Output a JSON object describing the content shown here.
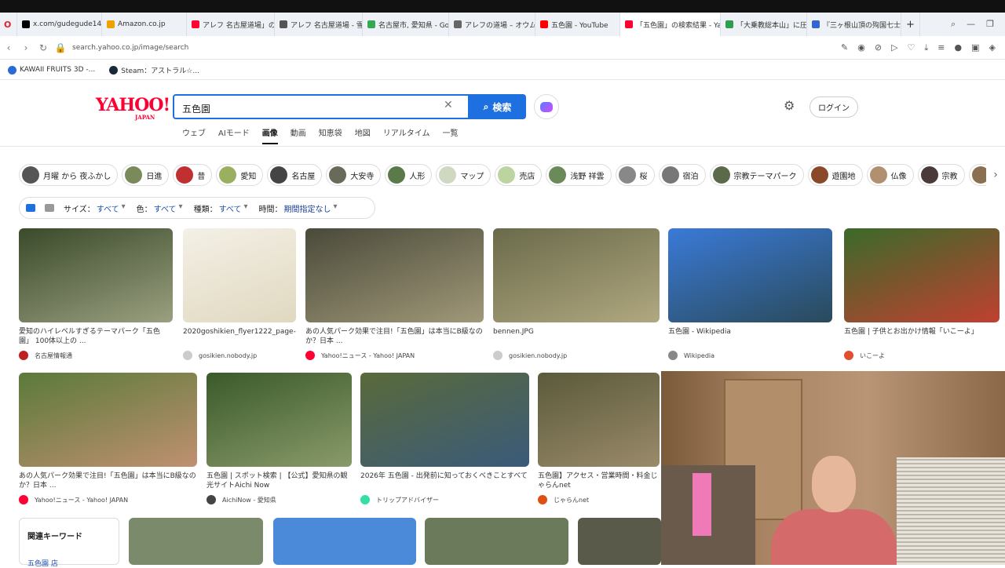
{
  "browser": {
    "tabs": [
      {
        "label": "x.com/gudegude147/...",
        "color": "#000000"
      },
      {
        "label": "Amazon.co.jp",
        "color": "#f0a000"
      },
      {
        "label": "アレフ 名古屋道場」の...",
        "color": "#ff0033"
      },
      {
        "label": "アレフ 名古屋道場 - 雪...",
        "color": "#555555"
      },
      {
        "label": "名古屋市, 愛知県 - Go...",
        "color": "#34a853"
      },
      {
        "label": "アレフの道場 – オウム真...",
        "color": "#666666"
      },
      {
        "label": "五色園 - YouTube",
        "color": "#ff0000"
      },
      {
        "label": "「五色園」の検索結果 - Yah...",
        "color": "#ff0033"
      },
      {
        "label": "「大乗教総本山」に圧倒...",
        "color": "#2e9e4e"
      },
      {
        "label": "『三ヶ根山頂の殉国七士...",
        "color": "#3366cc"
      }
    ],
    "url": "search.yahoo.co.jp/image/search",
    "bookmarks": [
      {
        "label": "KAWAII FRUITS 3D -...",
        "color": "#2a6bd6"
      },
      {
        "label": "Steam：アストラル☆...",
        "color": "#1b2838"
      }
    ]
  },
  "header": {
    "logo": "YAHOO!",
    "logo_sub": "JAPAN",
    "query": "五色園",
    "search_label": "検索",
    "login_label": "ログイン",
    "tabs": [
      "ウェブ",
      "AIモード",
      "画像",
      "動画",
      "知恵袋",
      "地図",
      "リアルタイム",
      "一覧"
    ]
  },
  "chips": [
    {
      "label": "月曜 から 夜ふかし",
      "color": "#555555"
    },
    {
      "label": "日進",
      "color": "#7a8a5a"
    },
    {
      "label": "昔",
      "color": "#c03030"
    },
    {
      "label": "愛知",
      "color": "#9ab060"
    },
    {
      "label": "名古屋",
      "color": "#444444"
    },
    {
      "label": "大安寺",
      "color": "#6a6a5a"
    },
    {
      "label": "人形",
      "color": "#5a7a4a"
    },
    {
      "label": "マップ",
      "color": "#cfd8c0"
    },
    {
      "label": "売店",
      "color": "#bcd4a0"
    },
    {
      "label": "浅野 祥雲",
      "color": "#6a8a5a"
    },
    {
      "label": "桜",
      "color": "#888888"
    },
    {
      "label": "宿泊",
      "color": "#777777"
    },
    {
      "label": "宗教テーマパーク",
      "color": "#5a6a4a"
    },
    {
      "label": "遊園地",
      "color": "#8a4a2a"
    },
    {
      "label": "仏像",
      "color": "#b09070"
    },
    {
      "label": "宗教",
      "color": "#4a3a3a"
    },
    {
      "label": "",
      "color": "#8a7050"
    }
  ],
  "filters": {
    "size_label": "サイズ：",
    "size_value": "すべて",
    "color_label": "色：",
    "color_value": "すべて",
    "type_label": "種類：",
    "type_value": "すべて",
    "time_label": "時間：",
    "time_value": "期間指定なし"
  },
  "results_row1": [
    {
      "title": "愛知のハイレベルすぎるテーマパーク「五色園」 100体以上の ...",
      "source": "名古屋情報通",
      "grad": [
        "#3a4a2a",
        "#9aa080"
      ],
      "favcolor": "#c02020"
    },
    {
      "title": "2020goshikien_flyer1222_page-...",
      "source": "gosikien.nobody.jp",
      "grad": [
        "#f4f0e6",
        "#e0d8c0"
      ],
      "favcolor": "#cccccc"
    },
    {
      "title": "あの人気パーク効果で注目!「五色園」は本当にB級なのか？日本 ...",
      "source": "Yahoo!ニュース - Yahoo! JAPAN",
      "grad": [
        "#4a4a3a",
        "#a09878"
      ],
      "favcolor": "#ff0033"
    },
    {
      "title": "bennen.JPG",
      "source": "gosikien.nobody.jp",
      "grad": [
        "#6a6a4a",
        "#b0a880"
      ],
      "favcolor": "#cccccc"
    },
    {
      "title": "五色園 - Wikipedia",
      "source": "Wikipedia",
      "grad": [
        "#3a7ad8",
        "#2a4a5a"
      ],
      "favcolor": "#888888"
    },
    {
      "title": "五色園 | 子供とお出かけ情報「いこーよ」",
      "source": "いこーよ",
      "grad": [
        "#3a6a2a",
        "#c04030"
      ],
      "favcolor": "#e05030"
    }
  ],
  "results_row2": [
    {
      "title": "あの人気パーク効果で注目!「五色園」は本当にB級なのか？日本 ...",
      "source": "Yahoo!ニュース - Yahoo! JAPAN",
      "grad": [
        "#5a7a3a",
        "#c09070"
      ],
      "favcolor": "#ff0033"
    },
    {
      "title": "五色園 | スポット検索 | 【公式】愛知県の観光サイトAichi Now",
      "source": "AichiNow - 愛知県",
      "grad": [
        "#3a5a2a",
        "#8a9a6a"
      ],
      "favcolor": "#444444"
    },
    {
      "title": "2026年 五色園 - 出発前に知っておくべきことすべて",
      "source": "トリップアドバイザー",
      "grad": [
        "#5a6a3a",
        "#3a5a7a"
      ],
      "favcolor": "#34e0a1"
    },
    {
      "title": "五色園】アクセス・営業時間・料金じゃらんnet",
      "source": "じゃらんnet",
      "grad": [
        "#5a5a3a",
        "#9a8a6a"
      ],
      "favcolor": "#e05010"
    }
  ],
  "related_title": "関連キーワード",
  "related_sub": "五色園 店",
  "bottom_thumbs": [
    {
      "color": "#7a8a6a"
    },
    {
      "color": "#4a8ad8"
    },
    {
      "color": "#6a7a5a"
    },
    {
      "color": "#5a5a4a"
    }
  ]
}
